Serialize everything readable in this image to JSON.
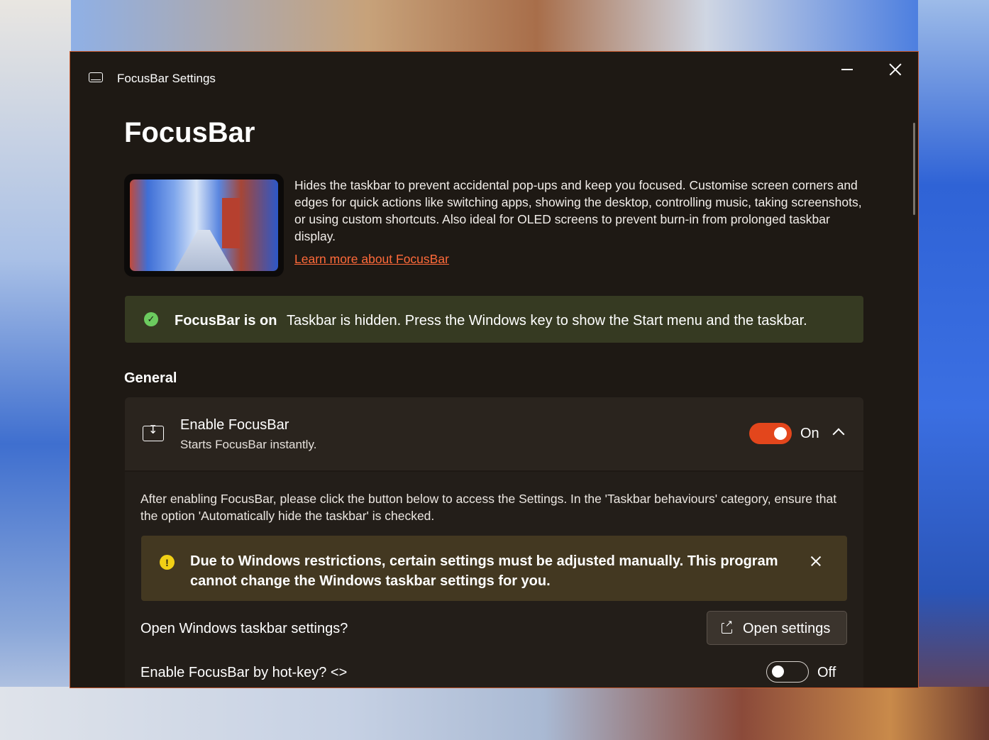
{
  "window": {
    "title": "FocusBar Settings"
  },
  "page": {
    "title": "FocusBar",
    "description": "Hides the taskbar to prevent accidental pop-ups and keep you focused. Customise screen corners and edges for quick actions like switching apps, showing the desktop, controlling music, taking screenshots, or using custom shortcuts. Also ideal for OLED screens to prevent burn-in from prolonged taskbar display.",
    "learn_more": "Learn more about FocusBar"
  },
  "status": {
    "title": "FocusBar is on",
    "message": "Taskbar is hidden. Press the Windows key to show the Start menu and the taskbar.",
    "icon": "checkmark-circle-icon",
    "color": "#6ccb5f"
  },
  "general": {
    "section_title": "General",
    "enable": {
      "title": "Enable FocusBar",
      "subtitle": "Starts FocusBar instantly.",
      "state_label": "On",
      "state": true
    },
    "expanded_text": "After enabling FocusBar, please click the button below to access the Settings. In the 'Taskbar behaviours' category, ensure that the option 'Automatically hide the taskbar' is checked.",
    "warning": {
      "text": "Due to Windows restrictions, certain settings must be adjusted manually. This program cannot change the Windows taskbar settings for you.",
      "icon": "warning-icon",
      "color": "#f1d015"
    },
    "open_taskbar": {
      "label": "Open Windows taskbar settings?",
      "button": "Open settings"
    },
    "hotkey": {
      "label": "Enable FocusBar by hot-key? <>",
      "state_label": "Off",
      "state": false
    }
  },
  "colors": {
    "accent": "#e3461c",
    "link": "#ff6a3a",
    "window_bg": "#1e1914"
  }
}
